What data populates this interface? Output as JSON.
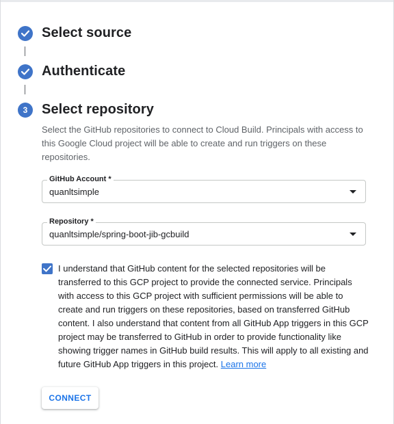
{
  "steps": [
    {
      "number": "1",
      "title": "Select source",
      "status": "complete"
    },
    {
      "number": "2",
      "title": "Authenticate",
      "status": "complete"
    },
    {
      "number": "3",
      "title": "Select repository",
      "status": "active"
    }
  ],
  "description": "Select the GitHub repositories to connect to Cloud Build. Principals with access to this Google Cloud project will be able to create and run triggers on these repositories.",
  "github_account": {
    "label": "GitHub Account *",
    "value": "quanltsimple"
  },
  "repository": {
    "label": "Repository *",
    "value": "quanltsimple/spring-boot-jib-gcbuild"
  },
  "consent": {
    "checked": true,
    "text": "I understand that GitHub content for the selected repositories will be transferred to this GCP project to provide the connected service. Principals with access to this GCP project with sufficient permissions will be able to create and run triggers on these repositories, based on transferred GitHub content. I also understand that content from all GitHub App triggers in this GCP project may be transferred to GitHub in order to provide functionality like showing trigger names in GitHub build results. This will apply to all existing and future GitHub App triggers in this project.",
    "link_label": "Learn more"
  },
  "connect_button": {
    "label": "CONNECT"
  },
  "colors": {
    "accent": "#1a73e8",
    "step_icon": "#3f74c8",
    "text_primary": "#202124",
    "text_secondary": "#5f6368"
  }
}
